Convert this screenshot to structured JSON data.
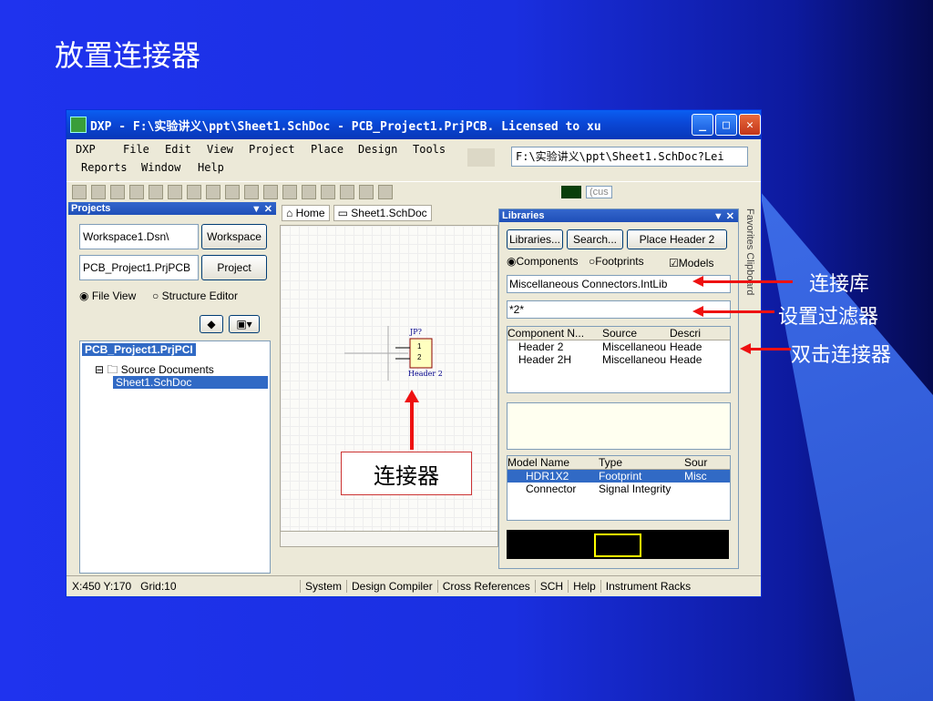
{
  "slide_title": "放置连接器",
  "window": {
    "title": "DXP - F:\\实验讲义\\ppt\\Sheet1.SchDoc - PCB_Project1.PrjPCB. Licensed to xu",
    "menu_row1": [
      "DXP",
      "File",
      "Edit",
      "View",
      "Project",
      "Place",
      "Design",
      "Tools"
    ],
    "menu_row2": [
      "Reports",
      "Window",
      "Help"
    ],
    "path_combo": "F:\\实验讲义\\ppt\\Sheet1.SchDoc?Lei",
    "color_combo": "(cus"
  },
  "projects_panel": {
    "title": "Projects",
    "workspace_value": "Workspace1.Dsn\\",
    "workspace_btn": "Workspace",
    "project_value": "PCB_Project1.PrjPCB",
    "project_btn": "Project",
    "radio_file": "File View",
    "radio_structure": "Structure Editor",
    "tree": [
      "PCB_Project1.PrjPCI",
      "Source Documents",
      "Sheet1.SchDoc"
    ]
  },
  "tabs": {
    "home": "Home",
    "sheet": "Sheet1.SchDoc"
  },
  "schematic": {
    "designator": "JP?",
    "pin1": "1",
    "pin2": "2",
    "part": "Header 2"
  },
  "libraries_panel": {
    "title": "Libraries",
    "btn_libraries": "Libraries...",
    "btn_search": "Search...",
    "btn_place": "Place Header 2",
    "radio_components": "Components",
    "radio_footprints": "Footprints",
    "check_models": "Models",
    "library": "Miscellaneous Connectors.IntLib",
    "filter": "*2*",
    "comp_headers": [
      "Component N...",
      "Source",
      "Descri"
    ],
    "comp_rows": [
      [
        "Header 2",
        "Miscellaneou",
        "Heade"
      ],
      [
        "Header 2H",
        "Miscellaneou",
        "Heade"
      ]
    ],
    "model_headers": [
      "Model Name",
      "Type",
      "Sour"
    ],
    "model_rows": [
      [
        "HDR1X2",
        "Footprint",
        "Misc"
      ],
      [
        "Connector",
        "Signal Integrity",
        ""
      ]
    ],
    "side_tabs": [
      "Favorites",
      "Clipboard"
    ]
  },
  "status": {
    "coords": "X:450 Y:170   Grid:10",
    "tabs": [
      "System",
      "Design Compiler",
      "Cross References",
      "SCH",
      "Help",
      "Instrument Racks"
    ]
  },
  "annotations": {
    "lib": "连接库",
    "filter": "设置过滤器",
    "dblclick": "双击连接器",
    "connector": "连接器"
  },
  "colors": {
    "accent_red": "#e11111",
    "selection": "#316ac5"
  }
}
